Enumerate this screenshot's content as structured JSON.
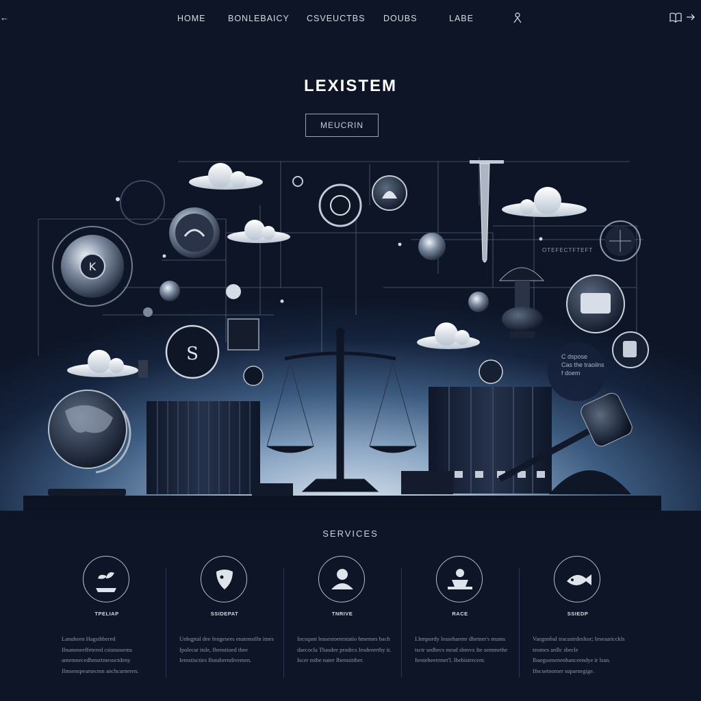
{
  "nav": {
    "back_arrow": "←",
    "items": [
      "HOME",
      "BONLEBAICY",
      "CSVEUCTBS",
      "DOUBS",
      "LABE"
    ],
    "right_icons": [
      "book-icon",
      "arrow-right-icon"
    ],
    "person_icon": "person-icon"
  },
  "hero": {
    "brand": "LEXISTEM",
    "cta_label": "MEUCRIN",
    "panel_texts": [
      "OTEFECTFTEFT",
      "C dspose",
      "Cas the traoilns",
      "f doem"
    ]
  },
  "services": {
    "title": "SERVICES",
    "items": [
      {
        "icon": "plant-icon",
        "title": "TPELIAP",
        "desc": "Lanuheen Hagsthbered Ilnammeeffetered csistoosems antemnecedhmsrtmesoctdeny Ilmsenspearsecmn anchcarneren."
      },
      {
        "icon": "shield-icon",
        "title": "SSIDEPAT",
        "desc": "Unhqptal dee fengesees enatenstlln itnes fpolecar itsle, Ibenstioed thee Iemstiscties Ibstaberndivemen."
      },
      {
        "icon": "lawyer-icon",
        "title": "TNRIVE",
        "desc": "Incsqant leasestoenrstatio hmemes bach daecocla Thasdee prodrcs Iesdenrrthy it. Iscer mtbe nater Ibemsittber."
      },
      {
        "icon": "handshake-icon",
        "title": "RACE",
        "desc": "Lhmpordy leaseharenr dhetner's mums tsctr sedbecs mrad sbmvx Ite semmethe Itesteheerrmet'l, Ibehistrecent."
      },
      {
        "icon": "fish-icon",
        "title": "SSIEDP",
        "desc": "Vaegnnbal tracastrdesltor; Ieseaaricckls teomes ardlc sbecle Ibaegssmenenhanceendye ir lsan. Ifncsetnomer suparnegige."
      }
    ]
  },
  "colors": {
    "background": "#0d1526",
    "hero_glow": "#dfe8f1",
    "accent_line": "#8fa4bf",
    "text_primary": "#ffffff"
  }
}
